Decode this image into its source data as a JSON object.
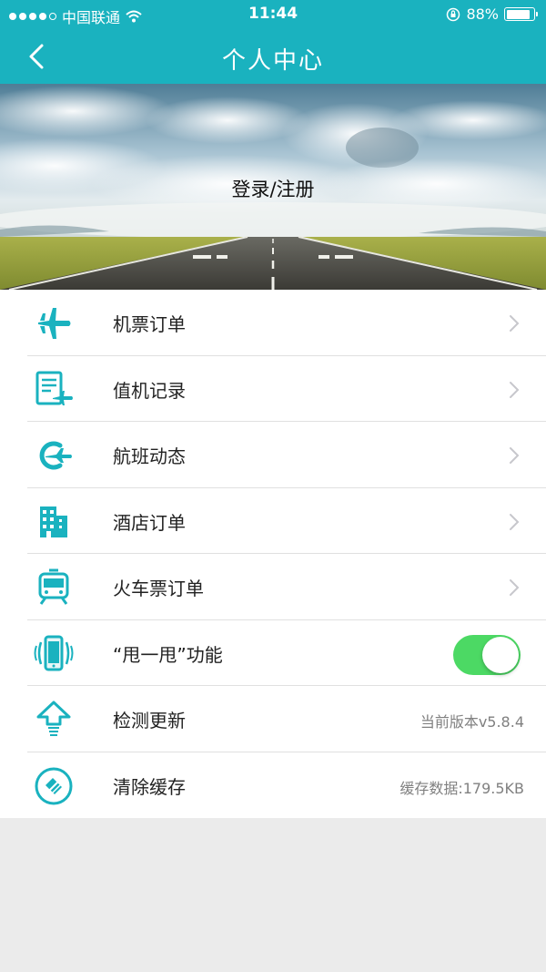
{
  "status_bar": {
    "carrier": "中国联通",
    "time": "11:44",
    "battery_percent": "88%",
    "battery_level": 0.88
  },
  "header": {
    "title": "个人中心",
    "back_icon": "chevron-left-icon",
    "background_color": "#1ab2bf"
  },
  "hero": {
    "login_label": "登录/注册"
  },
  "menu": {
    "accent_color": "#1ab2bf",
    "items": [
      {
        "label": "机票订单",
        "icon": "airplane-icon"
      },
      {
        "label": "值机记录",
        "icon": "checkin-record-icon"
      },
      {
        "label": "航班动态",
        "icon": "flight-status-icon"
      },
      {
        "label": "酒店订单",
        "icon": "hotel-building-icon"
      },
      {
        "label": "火车票订单",
        "icon": "train-icon"
      },
      {
        "label": "“甩一甩”功能",
        "icon": "shake-phone-icon",
        "toggle_on": true
      },
      {
        "label": "检测更新",
        "icon": "update-arrow-icon",
        "value": "当前版本v5.8.4"
      },
      {
        "label": "清除缓存",
        "icon": "clear-cache-icon",
        "value": "缓存数据:179.5KB"
      }
    ]
  }
}
